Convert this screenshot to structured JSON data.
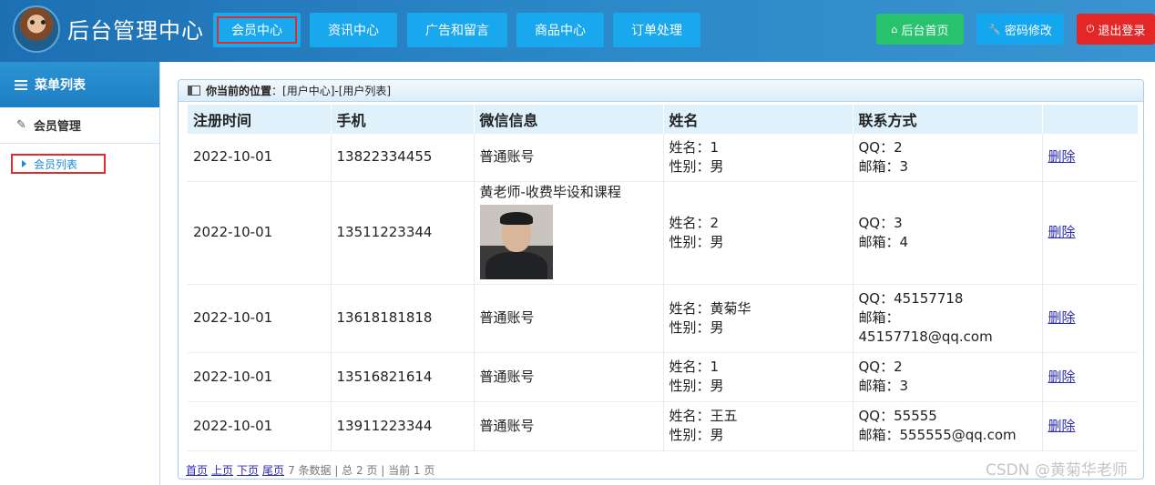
{
  "header": {
    "title": "后台管理中心",
    "nav": [
      "会员中心",
      "资讯中心",
      "广告和留言",
      "商品中心",
      "订单处理"
    ],
    "actions": {
      "home": "后台首页",
      "password": "密码修改",
      "logout": "退出登录"
    }
  },
  "colors": {
    "header": "#2381c2",
    "nav": "#19a7ee",
    "home": "#29c36f",
    "password": "#14a6ee",
    "logout": "#e32727"
  },
  "sidebar": {
    "title": "菜单列表",
    "group": "会员管理",
    "item": "会员列表"
  },
  "panel": {
    "location_label": "你当前的位置",
    "location_path": "：[用户中心]-[用户列表]",
    "columns": [
      "注册时间",
      "手机",
      "微信信息",
      "姓名",
      "联系方式",
      ""
    ],
    "rows": [
      {
        "date": "2022-10-01",
        "phone": "13822334455",
        "wechat": "普通账号",
        "name": "姓名：1",
        "gender": "性别：男",
        "qq": "QQ：2",
        "email": "邮箱：3",
        "action": "删除"
      },
      {
        "date": "2022-10-01",
        "phone": "13511223344",
        "wechat": "黄老师-收费毕设和课程",
        "name": "姓名：2",
        "gender": "性别：男",
        "qq": "QQ：3",
        "email": "邮箱：4",
        "action": "删除"
      },
      {
        "date": "2022-10-01",
        "phone": "13618181818",
        "wechat": "普通账号",
        "name": "姓名：黄菊华",
        "gender": "性别：男",
        "qq": "QQ：45157718",
        "email": "邮箱：",
        "email2": "45157718@qq.com",
        "action": "删除"
      },
      {
        "date": "2022-10-01",
        "phone": "13516821614",
        "wechat": "普通账号",
        "name": "姓名：1",
        "gender": "性别：男",
        "qq": "QQ：2",
        "email": "邮箱：3",
        "action": "删除"
      },
      {
        "date": "2022-10-01",
        "phone": "13911223344",
        "wechat": "普通账号",
        "name": "姓名：王五",
        "gender": "性别：男",
        "qq": "QQ：55555",
        "email": "邮箱：555555@qq.com",
        "action": "删除"
      }
    ],
    "pager": {
      "first": "首页",
      "prev": "上页",
      "next": "下页",
      "last": "尾页",
      "info": "7 条数据 | 总 2 页 | 当前 1 页"
    }
  },
  "watermark": "CSDN @黄菊华老师"
}
